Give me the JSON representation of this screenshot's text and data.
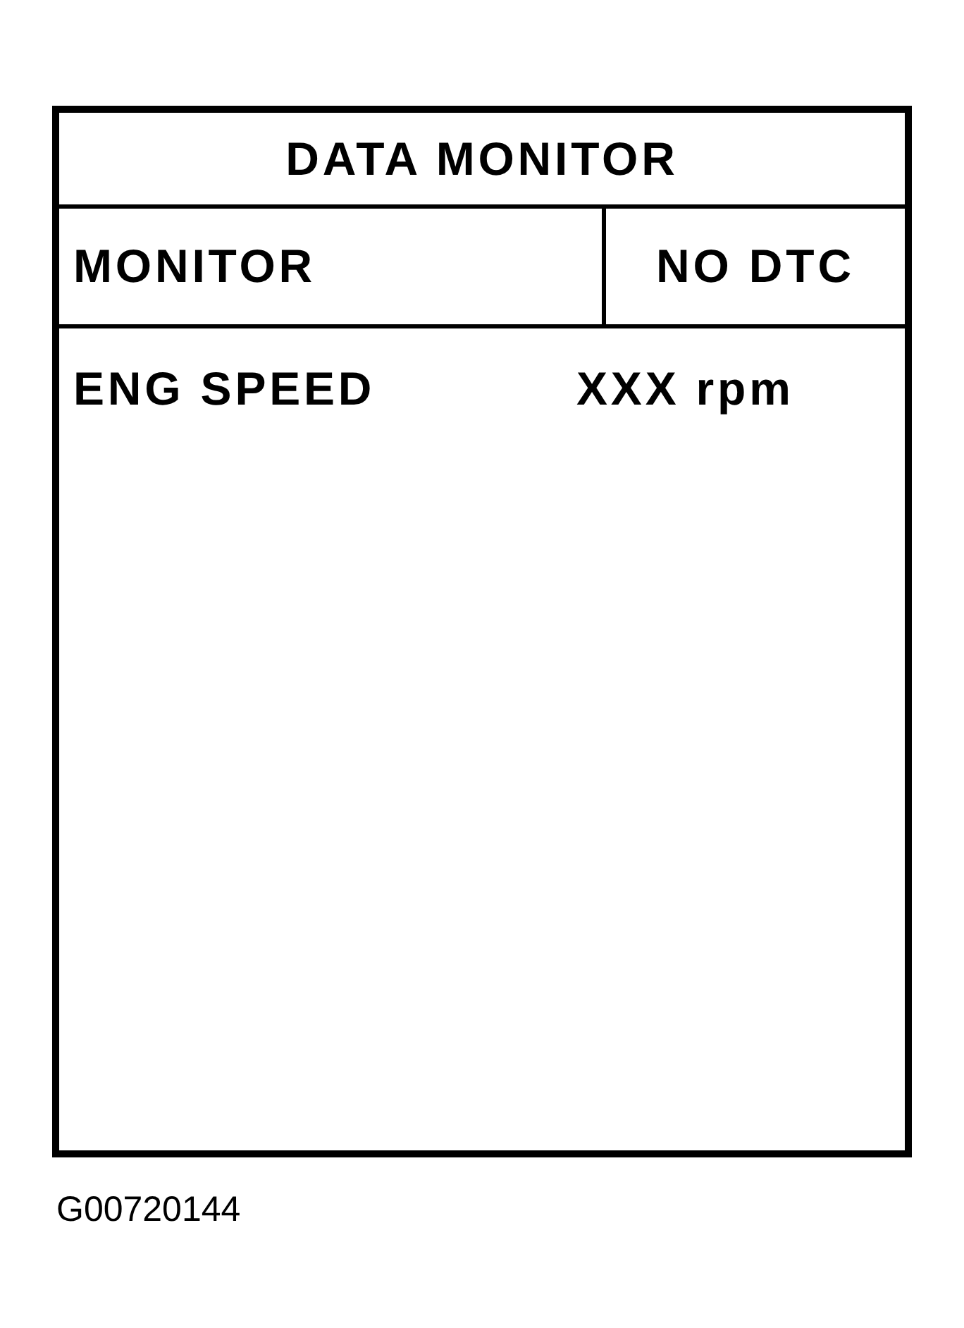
{
  "title": "DATA MONITOR",
  "header": {
    "mode": "MONITOR",
    "status": "NO DTC"
  },
  "rows": [
    {
      "label": "ENG SPEED",
      "value": "XXX rpm"
    }
  ],
  "figure_id": "G00720144"
}
